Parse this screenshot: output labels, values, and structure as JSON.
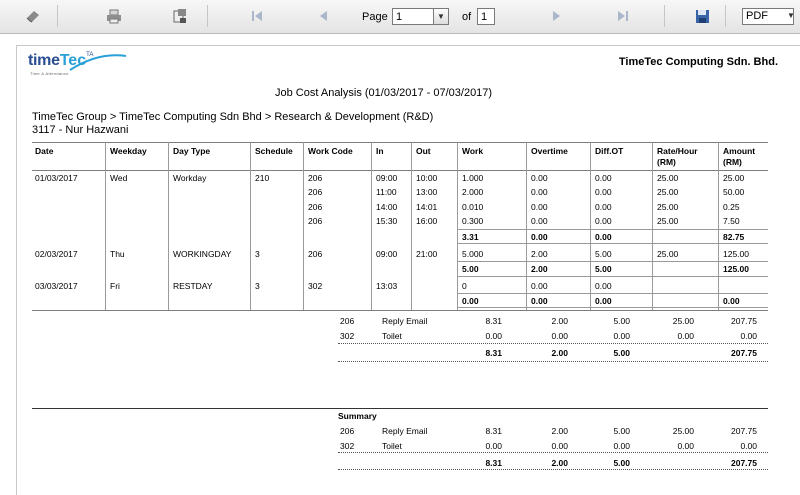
{
  "toolbar": {
    "page_label": "Page",
    "page_value": "1",
    "of_label": "of",
    "total_pages": "1",
    "export_format": "PDF",
    "icons": [
      "eraser-icon",
      "print-icon",
      "print-layout-icon",
      "first-page-icon",
      "previous-page-icon",
      "next-page-icon",
      "last-page-icon",
      "save-icon"
    ]
  },
  "report": {
    "logo_text_1": "time",
    "logo_text_2": "Tec",
    "logo_ta": "TA",
    "logo_tagline": "Time & Attendance",
    "company": "TimeTec Computing Sdn. Bhd.",
    "title": "Job Cost Analysis (01/03/2017 - 07/03/2017)",
    "path": "TimeTec Group > TimeTec Computing Sdn Bhd > Research & Development (R&D)",
    "employee": "3117 - Nur Hazwani"
  },
  "table": {
    "headers": [
      "Date",
      "Weekday",
      "Day Type",
      "Schedule",
      "Work Code",
      "In",
      "Out",
      "Work",
      "Overtime",
      "Diff.OT",
      "Rate/Hour\n(RM)",
      "Amount\n(RM)"
    ],
    "rows": [
      [
        "01/03/2017",
        "Wed",
        "Workday",
        "210",
        "206",
        "09:00",
        "10:00",
        "1.000",
        "0.00",
        "0.00",
        "25.00",
        "25.00"
      ],
      [
        "",
        "",
        "",
        "",
        "206",
        "11:00",
        "13:00",
        "2.000",
        "0.00",
        "0.00",
        "25.00",
        "50.00"
      ],
      [
        "",
        "",
        "",
        "",
        "206",
        "14:00",
        "14:01",
        "0.010",
        "0.00",
        "0.00",
        "25.00",
        "0.25"
      ],
      [
        "",
        "",
        "",
        "",
        "206",
        "15:30",
        "16:00",
        "0.300",
        "0.00",
        "0.00",
        "25.00",
        "7.50"
      ],
      [
        "",
        "",
        "",
        "",
        "",
        "",
        "",
        "3.31",
        "0.00",
        "0.00",
        "",
        "82.75"
      ],
      [
        "02/03/2017",
        "Thu",
        "WORKINGDAY",
        "3",
        "206",
        "09:00",
        "21:00",
        "5.000",
        "2.00",
        "5.00",
        "25.00",
        "125.00"
      ],
      [
        "",
        "",
        "",
        "",
        "",
        "",
        "",
        "5.00",
        "2.00",
        "5.00",
        "",
        "125.00"
      ],
      [
        "03/03/2017",
        "Fri",
        "RESTDAY",
        "3",
        "302",
        "13:03",
        "",
        "0",
        "0.00",
        "0.00",
        "",
        ""
      ],
      [
        "",
        "",
        "",
        "",
        "",
        "",
        "",
        "0.00",
        "0.00",
        "0.00",
        "",
        "0.00"
      ]
    ]
  },
  "employee_summary": {
    "rows": [
      [
        "206",
        "Reply Email",
        "8.31",
        "2.00",
        "5.00",
        "25.00",
        "207.75"
      ],
      [
        "302",
        "Toilet",
        "0.00",
        "0.00",
        "0.00",
        "0.00",
        "0.00"
      ]
    ],
    "total": [
      "8.31",
      "2.00",
      "5.00",
      "207.75"
    ]
  },
  "summary": {
    "title": "Summary",
    "rows": [
      [
        "206",
        "Reply Email",
        "8.31",
        "2.00",
        "5.00",
        "25.00",
        "207.75"
      ],
      [
        "302",
        "Toilet",
        "0.00",
        "0.00",
        "0.00",
        "0.00",
        "0.00"
      ]
    ],
    "total": [
      "8.31",
      "2.00",
      "5.00",
      "207.75"
    ]
  }
}
